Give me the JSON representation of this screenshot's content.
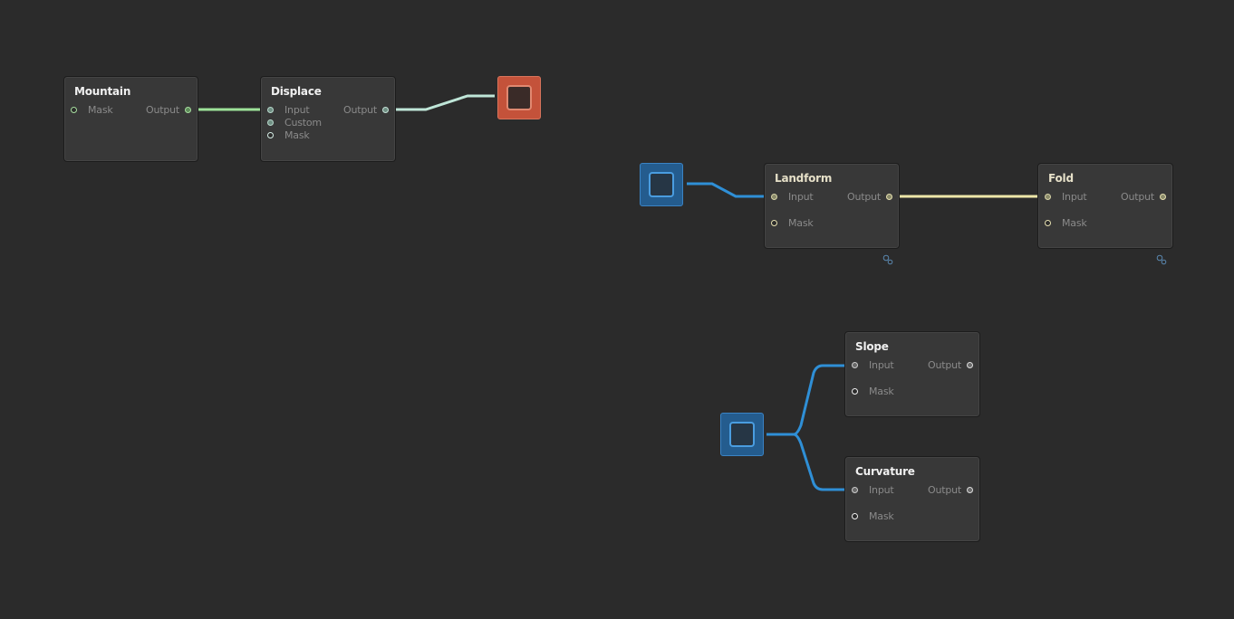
{
  "colors": {
    "background": "#2b2b2b",
    "wire_green": "#9ee39a",
    "wire_mint": "#bfe6d8",
    "wire_yellow": "#ede6a8",
    "wire_blue": "#2f8fd6",
    "anchor_red": "#c4523a",
    "anchor_blue": "#245c8e"
  },
  "nodes": {
    "mountain": {
      "title": "Mountain",
      "mask_label": "Mask",
      "output_label": "Output"
    },
    "displace": {
      "title": "Displace",
      "input_label": "Input",
      "custom_label": "Custom",
      "mask_label": "Mask",
      "output_label": "Output"
    },
    "landform": {
      "title": "Landform",
      "input_label": "Input",
      "mask_label": "Mask",
      "output_label": "Output"
    },
    "fold": {
      "title": "Fold",
      "input_label": "Input",
      "mask_label": "Mask",
      "output_label": "Output"
    },
    "slope": {
      "title": "Slope",
      "input_label": "Input",
      "mask_label": "Mask",
      "output_label": "Output"
    },
    "curvature": {
      "title": "Curvature",
      "input_label": "Input",
      "mask_label": "Mask",
      "output_label": "Output"
    }
  },
  "icons": {
    "anchor": "square-portal-icon",
    "settings": "node-settings-icon"
  }
}
